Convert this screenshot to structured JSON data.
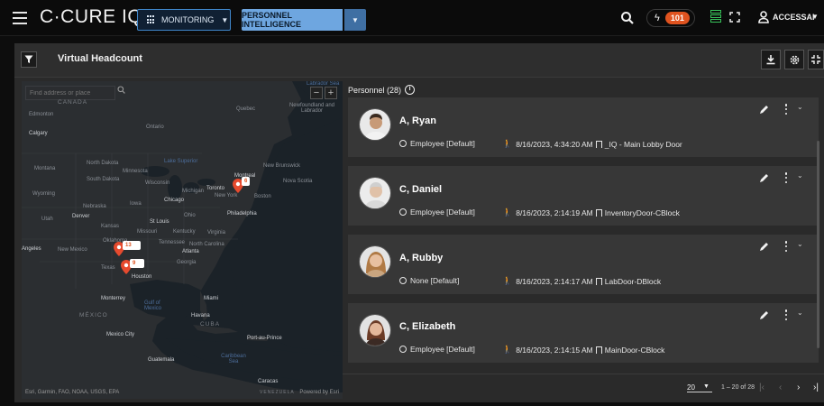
{
  "app": {
    "brand": "C·CURE IQ",
    "nav_monitoring": "MONITORING",
    "nav_personnel_intelligence": "PERSONNEL INTELLIGENCE",
    "alarm_count": "101",
    "user_name": "ACCESSAI"
  },
  "panel": {
    "title": "Virtual Headcount"
  },
  "map": {
    "search_placeholder": "Find address or place",
    "zoom_in": "+",
    "zoom_out": "−",
    "attribution": "Esri, Garmin, FAO, NOAA, USGS, EPA",
    "powered_by": "Powered by Esri",
    "labels": {
      "canada": "CANADA",
      "edmonton": "Edmonton",
      "calgary": "Calgary",
      "ontario": "Ontario",
      "quebec": "Quebec",
      "newfoundland": "Newfoundland and Labrador",
      "lake_superior": "Lake Superior",
      "labrador_sea": "Labrador Sea",
      "montana": "Montana",
      "north_dakota": "North Dakota",
      "minnesota": "Minnesota",
      "south_dakota": "South Dakota",
      "wisconsin": "Wisconsin",
      "wyoming": "Wyoming",
      "nebraska": "Nebraska",
      "iowa": "Iowa",
      "michigan": "Michigan",
      "chicago": "Chicago",
      "toronto": "Toronto",
      "montreal": "Montreal",
      "new_brunswick": "New Brunswick",
      "nova_scotia": "Nova Scotia",
      "new_york": "New York",
      "boston": "Boston",
      "ohio": "Ohio",
      "philadelphia": "Philadelphia",
      "utah": "Utah",
      "denver": "Denver",
      "kansas": "Kansas",
      "st_louis": "St Louis",
      "missouri": "Missouri",
      "kentucky": "Kentucky",
      "virginia": "Virginia",
      "oklahoma": "Oklahoma",
      "tennessee": "Tennessee",
      "north_carolina": "North Carolina",
      "angeles": "Angeles",
      "new_mexico": "New Mexico",
      "atlanta": "Atlanta",
      "texas": "Texas",
      "georgia": "Georgia",
      "houston": "Houston",
      "monterrey": "Monterrey",
      "gulf_of_mexico": "Gulf of Mexico",
      "miami": "Miami",
      "mexico": "MÉXICO",
      "havana": "Havana",
      "cuba": "CUBA",
      "mexico_city": "Mexico City",
      "port_au_prince": "Port-au-Prince",
      "guatemala": "Guatemala",
      "caribbean_sea": "Caribbean Sea",
      "caracas": "Caracas",
      "venezuela": "VENEZUELA"
    },
    "pins": [
      {
        "badge": "6"
      },
      {
        "badge": "13"
      },
      {
        "badge": "9"
      }
    ]
  },
  "personnel": {
    "header": "Personnel (28)",
    "items": [
      {
        "name": "A, Ryan",
        "role": "Employee [Default]",
        "time": "8/16/2023, 4:34:20 AM",
        "door": "_IQ - Main Lobby Door"
      },
      {
        "name": "C, Daniel",
        "role": "Employee [Default]",
        "time": "8/16/2023, 2:14:19 AM",
        "door": "InventoryDoor-CBlock"
      },
      {
        "name": "A, Rubby",
        "role": "None [Default]",
        "time": "8/16/2023, 2:14:17 AM",
        "door": "LabDoor-DBlock"
      },
      {
        "name": "C, Elizabeth",
        "role": "Employee [Default]",
        "time": "8/16/2023, 2:14:15 AM",
        "door": "MainDoor-CBlock"
      }
    ]
  },
  "pagination": {
    "page_size": "20",
    "range": "1 – 20 of 28"
  }
}
